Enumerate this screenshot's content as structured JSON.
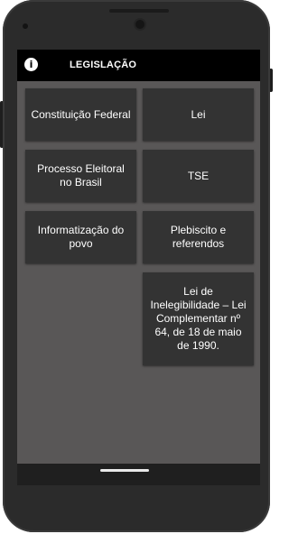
{
  "appbar": {
    "title": "LEGISLAÇÃO",
    "info_icon": "i"
  },
  "tiles": [
    {
      "label": "Constituição Federal"
    },
    {
      "label": "Lei"
    },
    {
      "label": "Processo Eleitoral no Brasil"
    },
    {
      "label": "TSE"
    },
    {
      "label": "Informatização do povo"
    },
    {
      "label": "Plebiscito e referendos"
    },
    {
      "label": "Lei de Inelegibilidade – Lei Complementar nº 64, de 18 de maio de 1990."
    }
  ]
}
